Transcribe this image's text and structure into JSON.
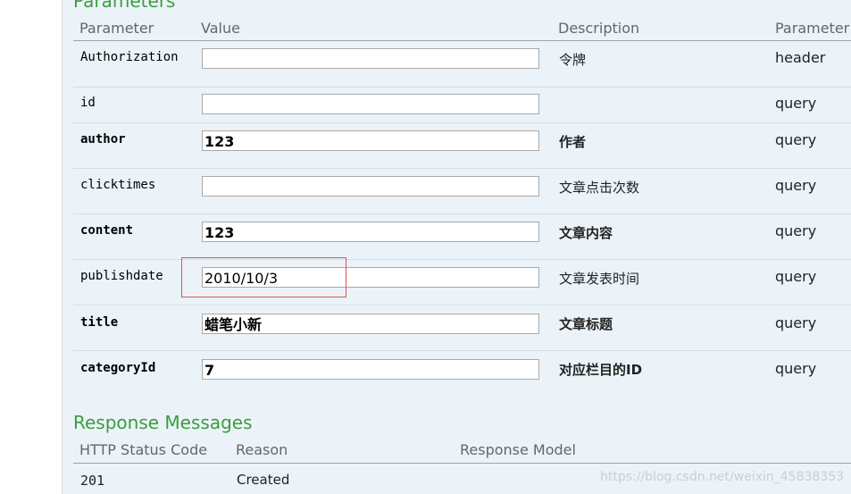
{
  "parameters": {
    "title": "Parameters",
    "headers": {
      "parameter": "Parameter",
      "value": "Value",
      "description": "Description",
      "parameter_type": "Parameter T"
    },
    "rows": [
      {
        "name": "Authorization",
        "value": "",
        "description": "令牌",
        "type": "header",
        "required": false
      },
      {
        "name": "id",
        "value": "",
        "description": "",
        "type": "query",
        "required": false
      },
      {
        "name": "author",
        "value": "123",
        "description": "作者",
        "type": "query",
        "required": true
      },
      {
        "name": "clicktimes",
        "value": "",
        "description": "文章点击次数",
        "type": "query",
        "required": false
      },
      {
        "name": "content",
        "value": "123",
        "description": "文章内容",
        "type": "query",
        "required": true
      },
      {
        "name": "publishdate",
        "value": "2010/10/3",
        "description": "文章发表时间",
        "type": "query",
        "required": false
      },
      {
        "name": "title",
        "value": "蜡笔小新",
        "description": "文章标题",
        "type": "query",
        "required": true
      },
      {
        "name": "categoryId",
        "value": "7",
        "description": "对应栏目的ID",
        "type": "query",
        "required": true
      }
    ]
  },
  "responses": {
    "title": "Response Messages",
    "headers": {
      "status_code": "HTTP Status Code",
      "reason": "Reason",
      "model": "Response Model"
    },
    "rows": [
      {
        "code": "201",
        "reason": "Created",
        "model": ""
      }
    ]
  },
  "watermark": "https://blog.csdn.net/weixin_45838353",
  "colors": {
    "section_title": "#3c9d3c",
    "panel_bg": "#ebf3f9",
    "highlight_border": "#d9534f"
  }
}
